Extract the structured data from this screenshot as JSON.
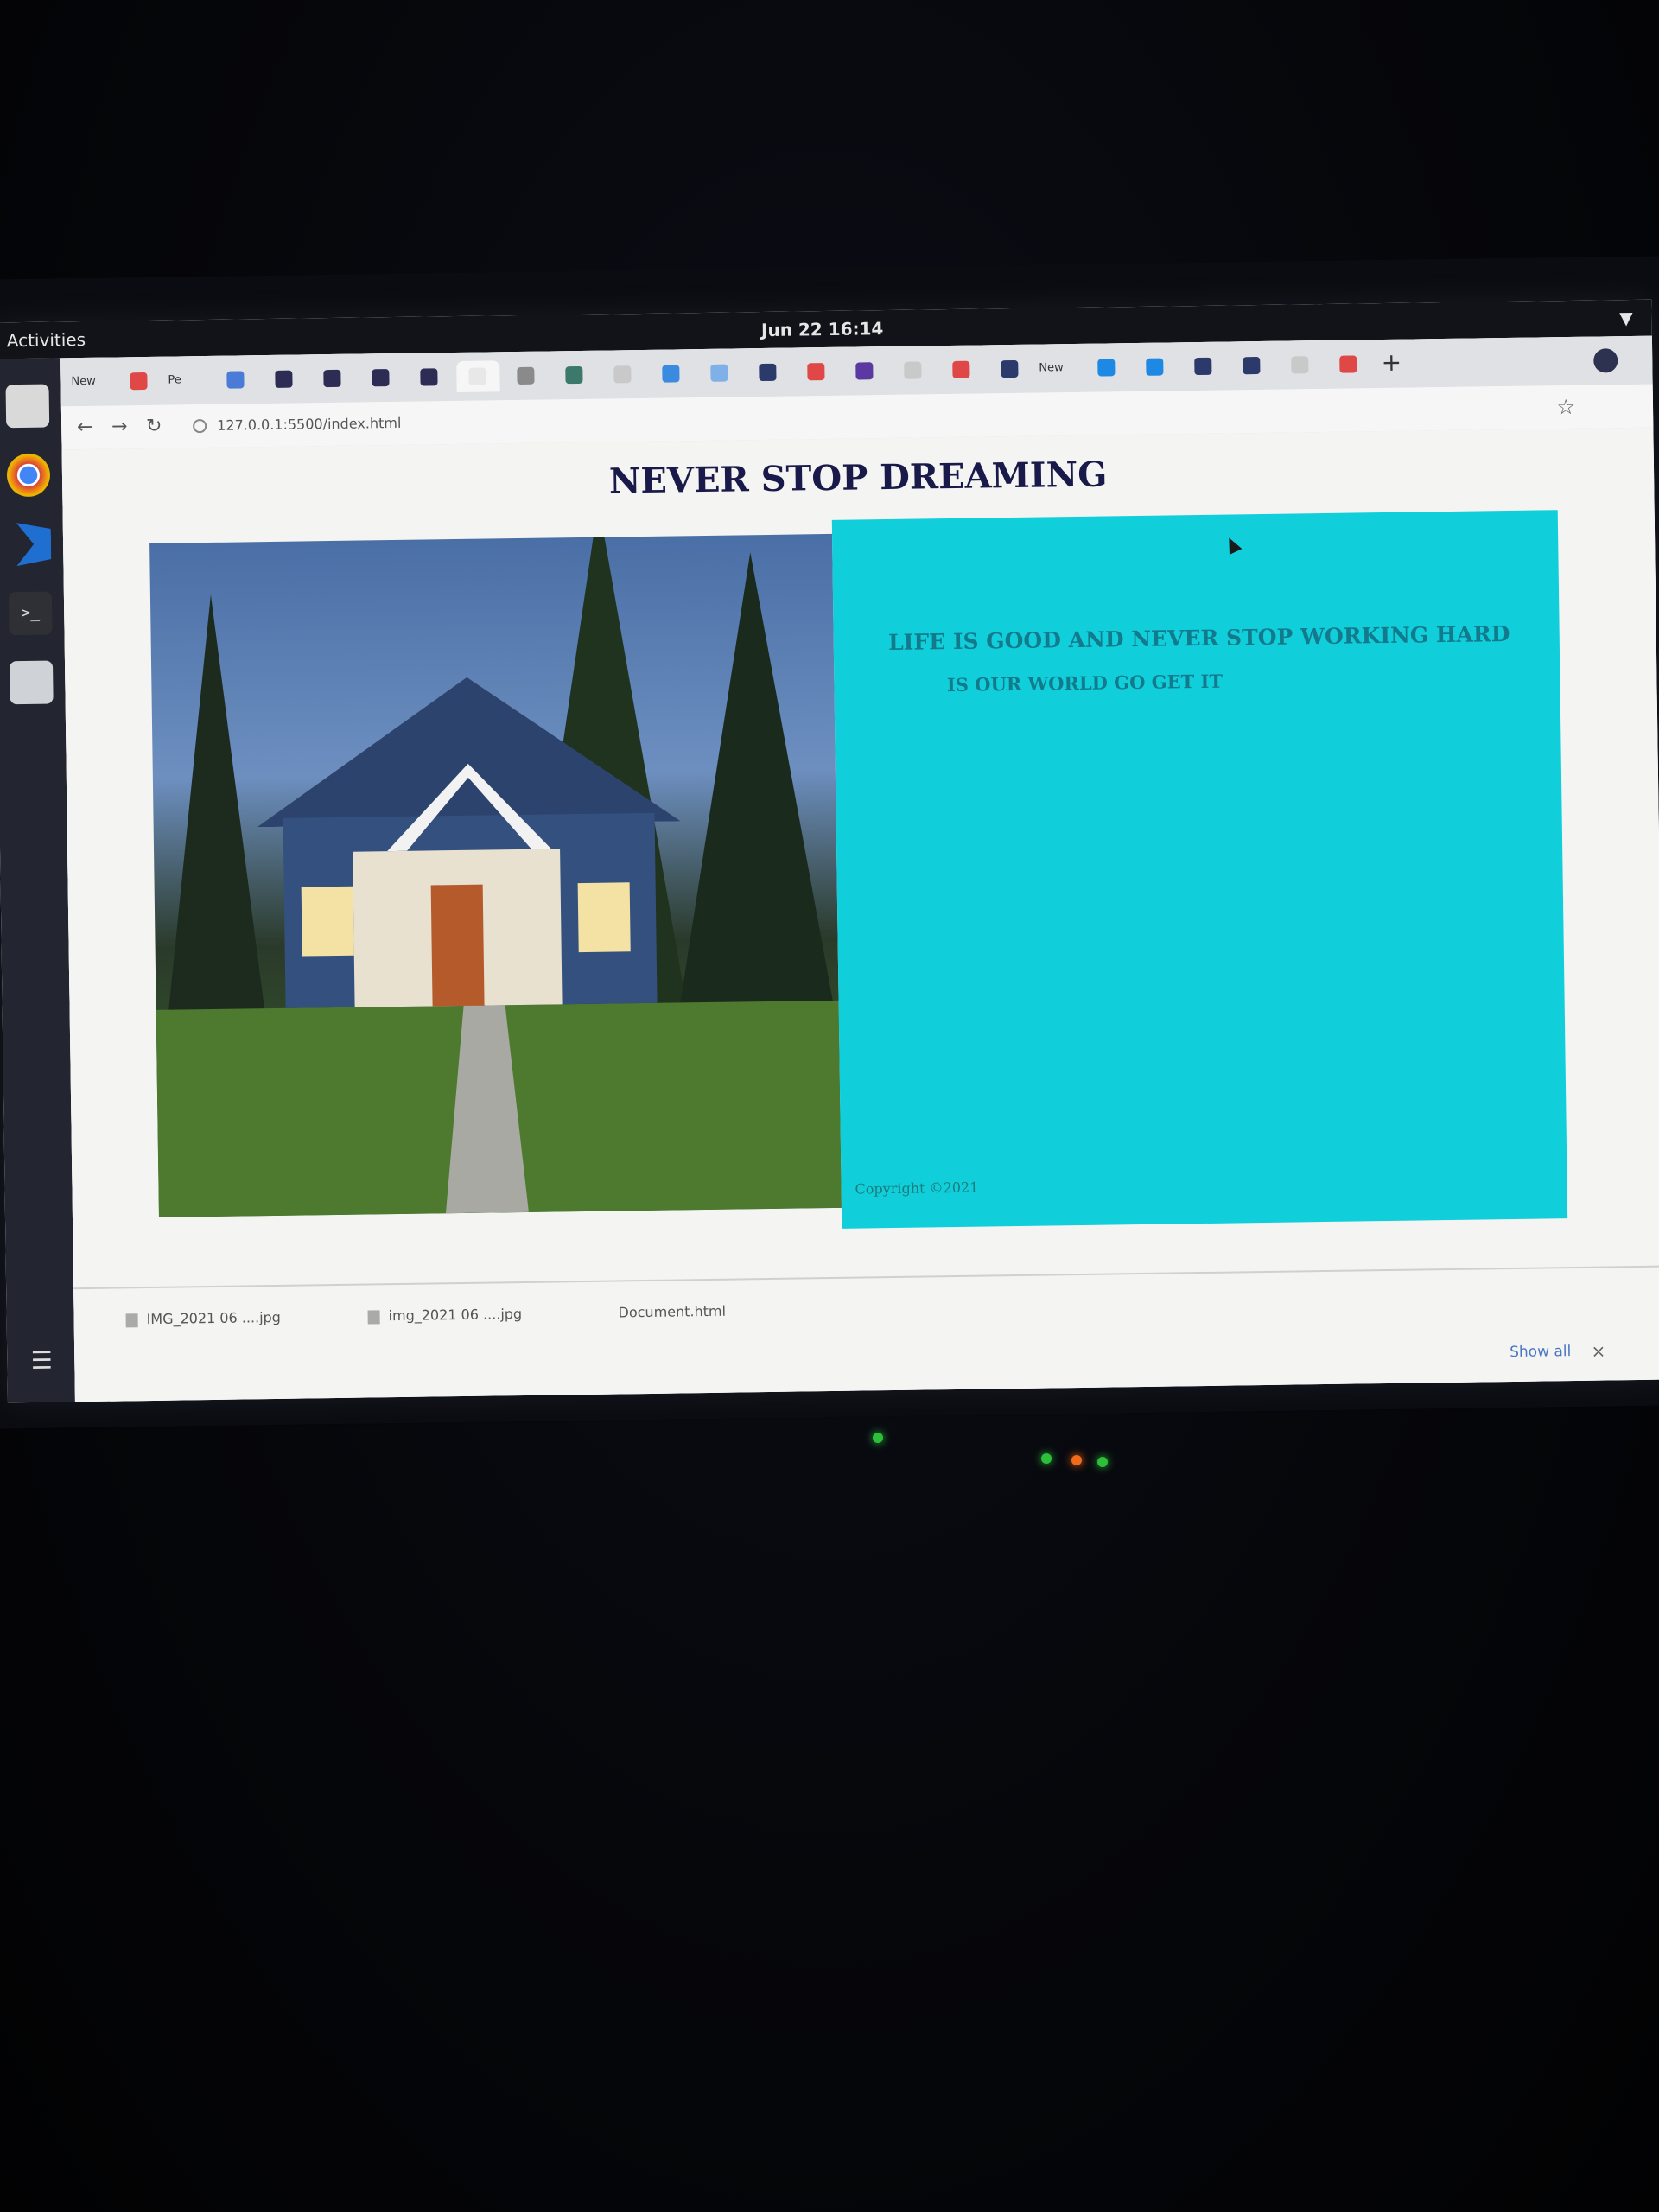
{
  "topbar": {
    "activities": "Activities",
    "app_menu": "",
    "clock": "Jun 22  16:14"
  },
  "browser": {
    "tabs": [
      {
        "label": "New",
        "color": "#6b6b6b"
      },
      {
        "label": "",
        "color": "#e04848"
      },
      {
        "label": "Pe",
        "color": "#6b6b6b"
      },
      {
        "label": "",
        "color": "#4a7bd6"
      },
      {
        "label": "",
        "color": "#2c2c54"
      },
      {
        "label": "",
        "color": "#2c2c54"
      },
      {
        "label": "",
        "color": "#2c2c54"
      },
      {
        "label": "",
        "color": "#2c2c54"
      },
      {
        "label": "",
        "color": "#e8e8e8"
      },
      {
        "label": "",
        "color": "#8a8a8a"
      },
      {
        "label": "",
        "color": "#3b7a6a"
      },
      {
        "label": "",
        "color": "#c9c9c9"
      },
      {
        "label": "",
        "color": "#3a8be0"
      },
      {
        "label": "",
        "color": "#7fb0e8"
      },
      {
        "label": "",
        "color": "#2c3a6b"
      },
      {
        "label": "",
        "color": "#e04848"
      },
      {
        "label": "",
        "color": "#5a3aa0"
      },
      {
        "label": "",
        "color": "#c9c9c9"
      },
      {
        "label": "",
        "color": "#e04848"
      },
      {
        "label": "",
        "color": "#2c3a6b"
      },
      {
        "label": "New",
        "color": "#6b6b6b"
      },
      {
        "label": "",
        "color": "#1e88e5"
      },
      {
        "label": "",
        "color": "#1e88e5"
      },
      {
        "label": "",
        "color": "#2c3a6b"
      },
      {
        "label": "",
        "color": "#2c3a6b"
      },
      {
        "label": "",
        "color": "#c9c9c9"
      },
      {
        "label": "",
        "color": "#e04848"
      }
    ],
    "url": "127.0.0.1:5500/index.html",
    "new_tab": "+"
  },
  "page": {
    "title": "NEVER STOP DREAMING",
    "tagline": "LIFE IS GOOD AND NEVER STOP WORKING HARD",
    "subline": "IS OUR WORLD GO GET IT",
    "copyright": "Copyright ©2021",
    "panel_color": "#10cfdb"
  },
  "downloads": {
    "items": [
      {
        "name": "IMG_2021 06 ....jpg"
      },
      {
        "name": "img_2021 06 ....jpg"
      },
      {
        "name": "Document.html"
      }
    ],
    "show_all": "Show all",
    "close": "×"
  },
  "icons": {
    "dock": [
      "files-icon",
      "chrome-icon",
      "vscode-icon",
      "terminal-icon",
      "screenshot-icon",
      "app-grid-icon"
    ],
    "toolbar": [
      "back-icon",
      "forward-icon",
      "reload-icon",
      "info-icon",
      "star-icon"
    ]
  }
}
